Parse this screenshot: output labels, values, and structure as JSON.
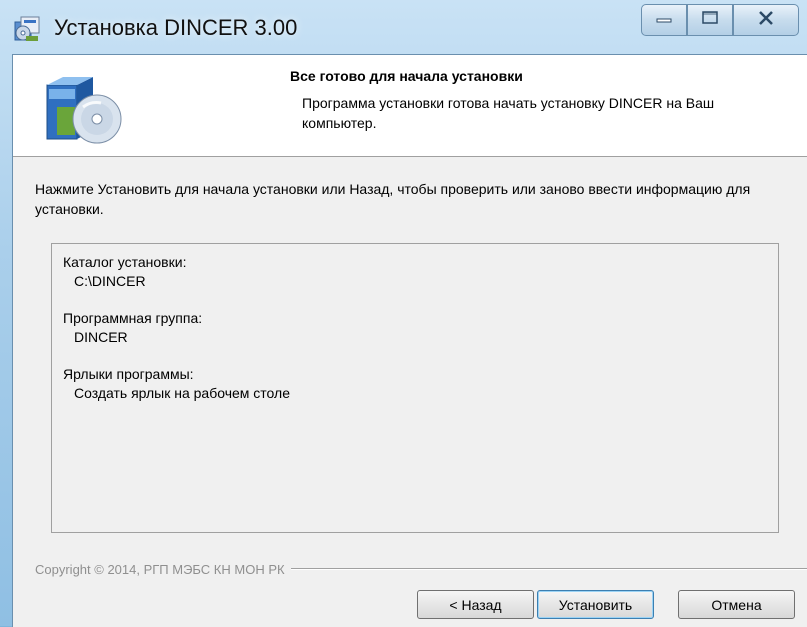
{
  "window": {
    "title": "Установка DINCER 3.00"
  },
  "header": {
    "title": "Все готово для начала установки",
    "subtitle": "Программа установки готова начать установку DINCER на Ваш компьютер."
  },
  "intro": "Нажмите Установить для начала установки или Назад, чтобы проверить или заново ввести информацию для установки.",
  "summary": {
    "install_dir_label": "Каталог установки:",
    "install_dir_value": "C:\\DINCER",
    "program_group_label": "Программная группа:",
    "program_group_value": "DINCER",
    "shortcuts_label": "Ярлыки программы:",
    "shortcuts_value": "Создать ярлык на рабочем столе"
  },
  "footer": {
    "copyright": "Copyright © 2014, РГП МЭБС КН МОН РК"
  },
  "buttons": {
    "back": "< Назад",
    "install": "Установить",
    "cancel": "Отмена"
  },
  "icons": {
    "app": "installer-box-icon",
    "header": "software-box-cd-icon",
    "minimize": "minimize-icon",
    "maximize": "maximize-icon",
    "close": "close-icon"
  },
  "colors": {
    "frame": "#aacfeb",
    "client": "#f0f0f0",
    "header_bg": "#ffffff",
    "default_button_border": "#3c7fb1"
  }
}
